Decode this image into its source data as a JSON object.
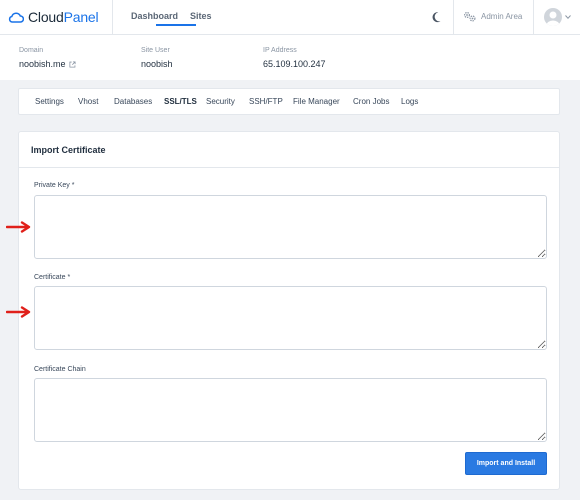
{
  "app": {
    "logo_cloud": "Cloud",
    "logo_panel": "Panel",
    "nav": [
      "Dashboard",
      "Sites"
    ],
    "admin_label": "Admin Area"
  },
  "site": {
    "domain_label": "Domain",
    "domain_value": "noobish.me",
    "user_label": "Site User",
    "user_value": "noobish",
    "ip_label": "IP Address",
    "ip_value": "65.109.100.247"
  },
  "tabs": [
    "Settings",
    "Vhost",
    "Databases",
    "SSL/TLS",
    "Security",
    "SSH/FTP",
    "File Manager",
    "Cron Jobs",
    "Logs"
  ],
  "active_tab": "SSL/TLS",
  "card": {
    "title": "Import Certificate",
    "fields": [
      {
        "label": "Private Key *",
        "value": ""
      },
      {
        "label": "Certificate *",
        "value": ""
      },
      {
        "label": "Certificate Chain",
        "value": ""
      }
    ],
    "submit_label": "Import and Install"
  },
  "colors": {
    "accent": "#1a73e8",
    "button": "#2a7ae2",
    "annotation_arrow": "#e0201a"
  }
}
